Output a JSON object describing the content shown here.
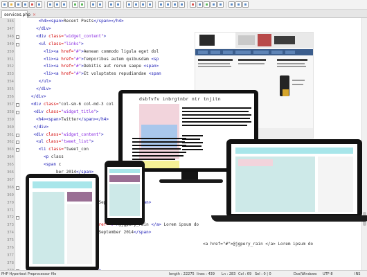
{
  "tab": {
    "label": "services.php",
    "close": "×"
  },
  "code_lines": [
    {
      "n": "346",
      "indent": 12,
      "text": "<h4><span>Recent Posts</span></h4>"
    },
    {
      "n": "347",
      "indent": 10,
      "text": "</div>"
    },
    {
      "n": "348",
      "indent": 10,
      "text": "<div class=\"widget_content\">"
    },
    {
      "n": "349",
      "indent": 12,
      "text": "<ul class=\"links\">"
    },
    {
      "n": "350",
      "indent": 16,
      "text": "<li><a href=\"#\">Aenean commodo ligula eget dol"
    },
    {
      "n": "351",
      "indent": 16,
      "text": "<li><a href=\"#\">Temporibus autem quibusdam <sp"
    },
    {
      "n": "352",
      "indent": 16,
      "text": "<li><a href=\"#\">Debitis aut rerum saepe <span>"
    },
    {
      "n": "353",
      "indent": 16,
      "text": "<li><a href=\"#\">Et voluptates repudiandae <span"
    },
    {
      "n": "354",
      "indent": 12,
      "text": "</ul>"
    },
    {
      "n": "355",
      "indent": 10,
      "text": "</div>"
    },
    {
      "n": "356",
      "indent": 6,
      "text": "</div>"
    },
    {
      "n": "357",
      "indent": 6,
      "text": "<div class=\"col-sm-6 col-md-3 col"
    },
    {
      "n": "358",
      "indent": 8,
      "text": "<div class=\"widget_title\">"
    },
    {
      "n": "359",
      "indent": 10,
      "text": "<h4><span>Twitter</span></h4>"
    },
    {
      "n": "360",
      "indent": 8,
      "text": "</div>"
    },
    {
      "n": "361",
      "indent": 8,
      "text": "<div class=\"widget_content\">"
    },
    {
      "n": "362",
      "indent": 10,
      "text": "<ul class=\"tweet_list\">"
    },
    {
      "n": "363",
      "indent": 12,
      "text": "<li class=\"tweet_con"
    },
    {
      "n": "364",
      "indent": 16,
      "text": "<p class"
    },
    {
      "n": "365",
      "indent": 16,
      "text": "<span c"
    },
    {
      "n": "366",
      "indent": 26,
      "text": "ber 2014</span>"
    },
    {
      "n": "367",
      "indent": 12,
      "text": "</li>"
    },
    {
      "n": "368",
      "indent": 12,
      "text": "<li class=\"tweet_con"
    },
    {
      "n": "369",
      "indent": 16,
      "text": "<p class"
    },
    {
      "n": "370",
      "indent": 16,
      "text": "<span class=\"time\">29 September 2014</span>"
    },
    {
      "n": "371",
      "indent": 12,
      "text": "</li>"
    },
    {
      "n": "372",
      "indent": 12,
      "text": "<li class=\"tweet_con"
    },
    {
      "n": "373",
      "indent": 16,
      "text": "<p class=\"tweet\"> <a href=\"#\">@jgpery_rain </a> Lorem ipsum do"
    },
    {
      "n": "374",
      "indent": 16,
      "text": "<span class=\"time\">29 September 2014</span>"
    },
    {
      "n": "375",
      "indent": 12,
      "text": "</li>"
    },
    {
      "n": "376",
      "indent": 10,
      "text": "</ul>"
    },
    {
      "n": "377",
      "indent": 8,
      "text": "</div>"
    },
    {
      "n": "378",
      "indent": 6,
      "text": "</div>"
    },
    {
      "n": "379",
      "indent": 6,
      "text": "<div class=\"widget_content\">"
    }
  ],
  "overlay_text": {
    "lorem_a": "<a href=\"#\">@jgpery_rain </a> Lorem ipsum do",
    "lorem_b": "</a> Lorem ipsum de",
    "monitor_heading": "dsbfvfv inbrgtnbr ntr tnjitn"
  },
  "statusbar": {
    "filetype": "PHP Hypertext Preprocessor file",
    "length": "length : 22275",
    "lines": "lines : 439",
    "ln": "Ln : 283",
    "col": "Col : 69",
    "sel": "Sel : 0 | 0",
    "eol": "Dos\\Windows",
    "encoding": "UTF-8",
    "mode": "INS"
  },
  "colors": {
    "tag": "#1515b3",
    "attr": "#d20000",
    "value": "#8a2be2",
    "text": "#2d2d2d",
    "screen_header": "#a8e6ea",
    "screen_pink": "#f2d4dc",
    "screen_purple": "#9a6f94",
    "screen_lightblue": "#a9c7ec",
    "screen_teal": "#cde9e8",
    "screen_yellow": "#f5f096"
  }
}
